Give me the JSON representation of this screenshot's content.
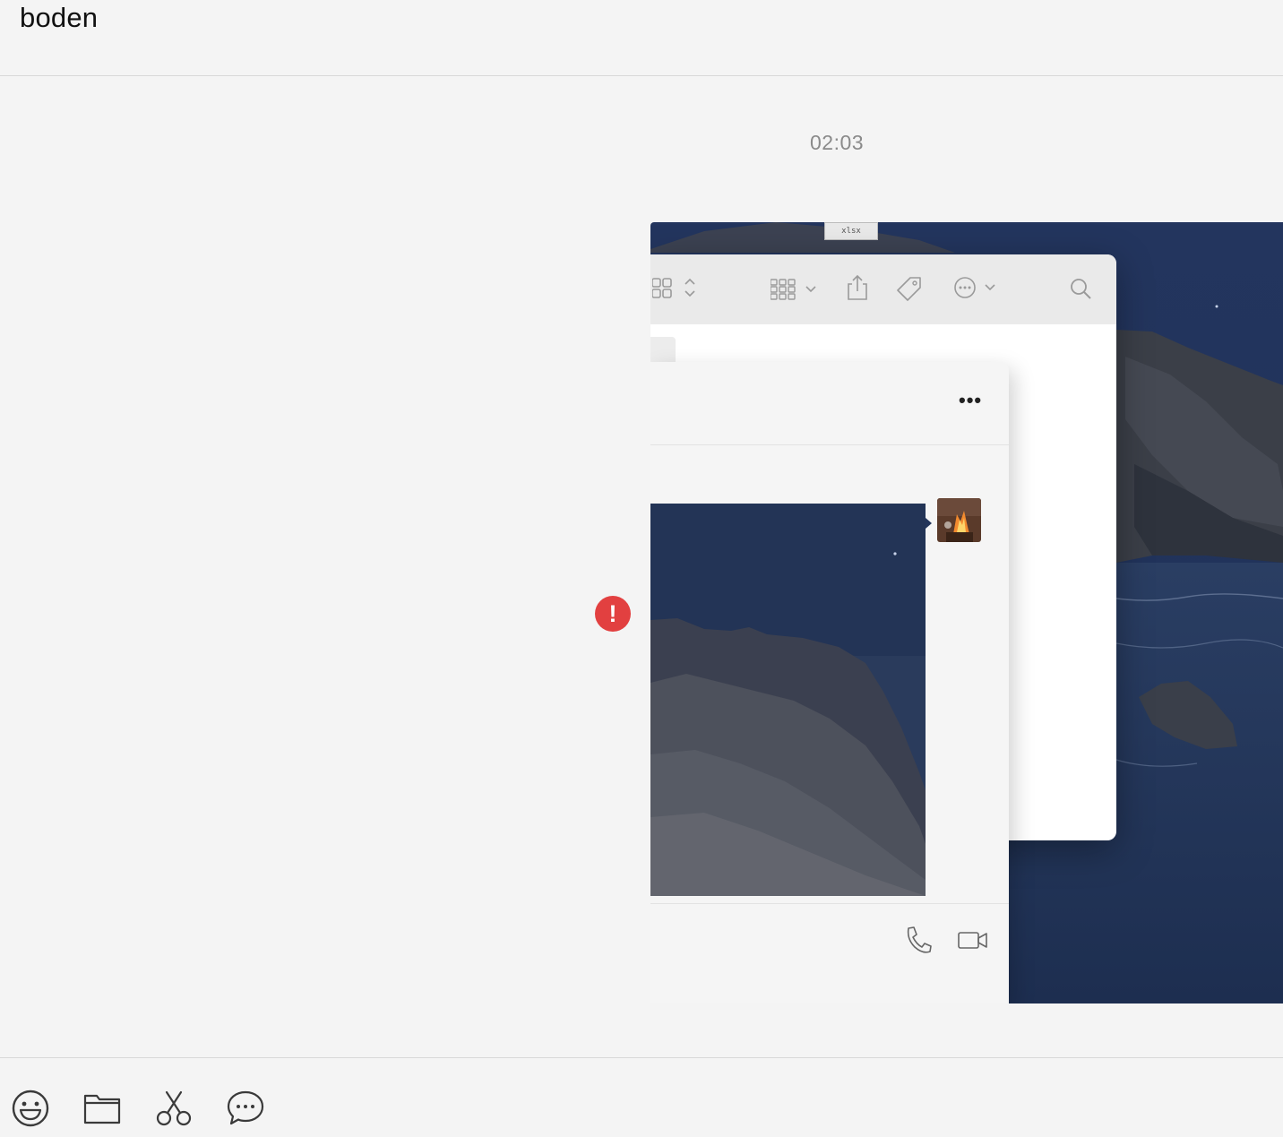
{
  "header": {
    "title": "boden"
  },
  "conversation": {
    "timestamp": "02:03",
    "message": {
      "type": "image",
      "status": "send-failed",
      "status_icon": "exclamation-icon",
      "status_color": "#e24040",
      "screenshot": {
        "file_tab_label": "xlsx",
        "finder_toolbar_icons": [
          "grid-view-icon",
          "group-icon",
          "share-icon",
          "tag-icon",
          "more-actions-icon",
          "search-icon"
        ],
        "chat_window": {
          "more_label": "•••",
          "footer_icons": [
            "phone-icon",
            "video-call-icon"
          ]
        }
      }
    }
  },
  "input_toolbar": {
    "icons": [
      "emoji-icon",
      "folder-icon",
      "screenshot-scissors-icon",
      "chat-bubble-icon"
    ]
  }
}
